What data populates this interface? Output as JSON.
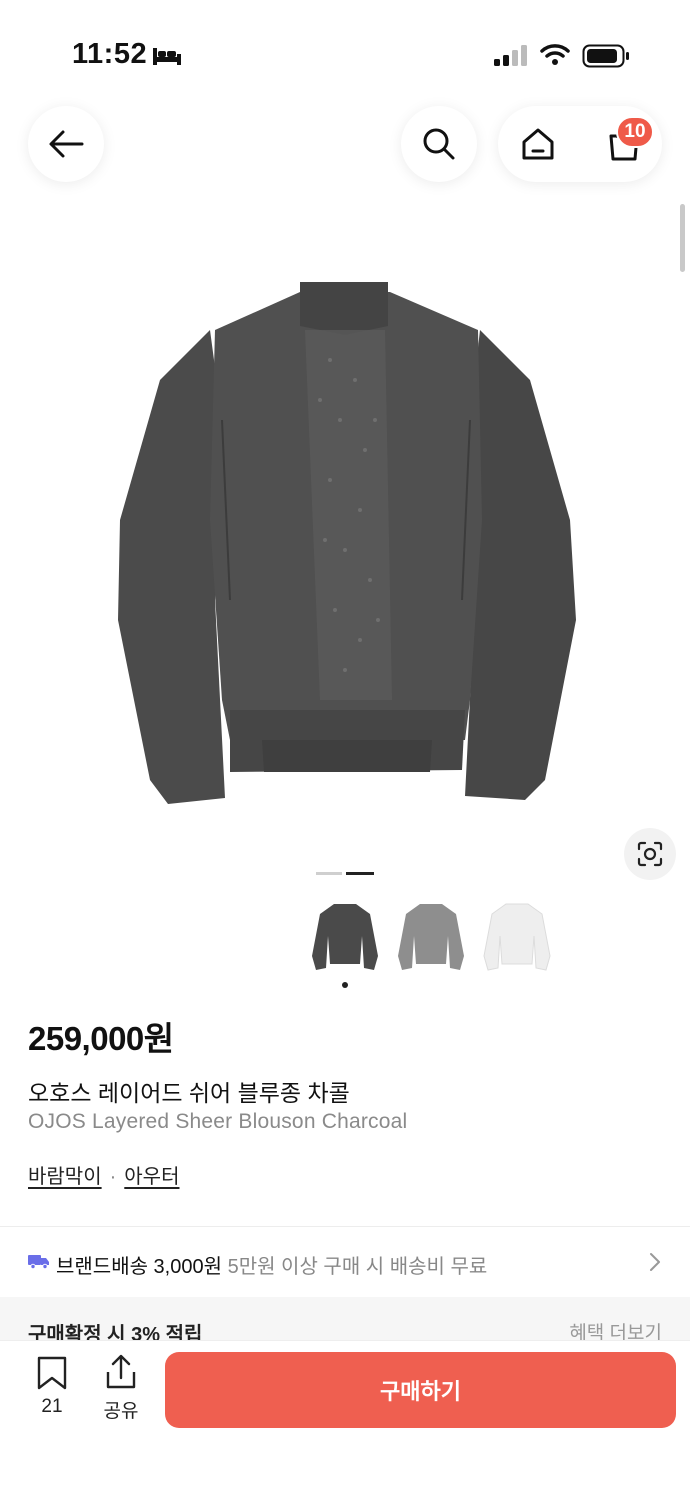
{
  "status_bar": {
    "time": "11:52"
  },
  "header": {
    "cart_count": "10"
  },
  "product": {
    "price": "259,000원",
    "name_ko": "오호스 레이어드 쉬어 블루종 차콜",
    "name_en": "OJOS Layered Sheer Blouson Charcoal",
    "category_1": "바람막이",
    "category_separator": "·",
    "category_2": "아우터",
    "color_variants": [
      "charcoal",
      "gray",
      "white"
    ],
    "colors": {
      "charcoal": "#4a4a4a",
      "gray": "#8e8e8e",
      "white": "#eeeeee"
    }
  },
  "delivery": {
    "label": "브랜드배송 3,000원",
    "sub": "5만원 이상 구매 시 배송비 무료"
  },
  "benefit": {
    "reward": "구매확정 시 3% 적립",
    "more": "혜택 더보기"
  },
  "bottom_bar": {
    "bookmark_count": "21",
    "share_label": "공유",
    "buy_label": "구매하기"
  },
  "accent": "#ef5f50"
}
